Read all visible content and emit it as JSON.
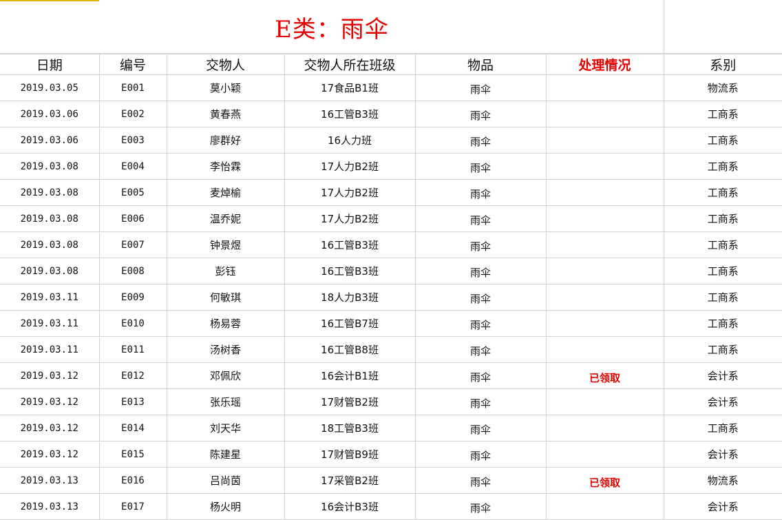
{
  "title": "E类：雨伞",
  "headers": {
    "date": "日期",
    "number": "编号",
    "person": "交物人",
    "class": "交物人所在班级",
    "item": "物品",
    "status": "处理情况",
    "department": "系别"
  },
  "rows": [
    {
      "date": "2019.03.05",
      "number": "E001",
      "person": "莫小颖",
      "class": "17食品B1班",
      "item": "雨伞",
      "status": "",
      "department": "物流系"
    },
    {
      "date": "2019.03.06",
      "number": "E002",
      "person": "黄春燕",
      "class": "16工管B3班",
      "item": "雨伞",
      "status": "",
      "department": "工商系"
    },
    {
      "date": "2019.03.06",
      "number": "E003",
      "person": "廖群好",
      "class": "16人力班",
      "item": "雨伞",
      "status": "",
      "department": "工商系"
    },
    {
      "date": "2019.03.08",
      "number": "E004",
      "person": "李怡霖",
      "class": "17人力B2班",
      "item": "雨伞",
      "status": "",
      "department": "工商系"
    },
    {
      "date": "2019.03.08",
      "number": "E005",
      "person": "麦焯榆",
      "class": "17人力B2班",
      "item": "雨伞",
      "status": "",
      "department": "工商系"
    },
    {
      "date": "2019.03.08",
      "number": "E006",
      "person": "温乔妮",
      "class": "17人力B2班",
      "item": "雨伞",
      "status": "",
      "department": "工商系"
    },
    {
      "date": "2019.03.08",
      "number": "E007",
      "person": "钟景煜",
      "class": "16工管B3班",
      "item": "雨伞",
      "status": "",
      "department": "工商系"
    },
    {
      "date": "2019.03.08",
      "number": "E008",
      "person": "彭钰",
      "class": "16工管B3班",
      "item": "雨伞",
      "status": "",
      "department": "工商系"
    },
    {
      "date": "2019.03.11",
      "number": "E009",
      "person": "何敏琪",
      "class": "18人力B3班",
      "item": "雨伞",
      "status": "",
      "department": "工商系"
    },
    {
      "date": "2019.03.11",
      "number": "E010",
      "person": "杨易蓉",
      "class": "16工管B7班",
      "item": "雨伞",
      "status": "",
      "department": "工商系"
    },
    {
      "date": "2019.03.11",
      "number": "E011",
      "person": "汤树香",
      "class": "16工管B8班",
      "item": "雨伞",
      "status": "",
      "department": "工商系"
    },
    {
      "date": "2019.03.12",
      "number": "E012",
      "person": "邓佩欣",
      "class": "16会计B1班",
      "item": "雨伞",
      "status": "已领取",
      "department": "会计系"
    },
    {
      "date": "2019.03.12",
      "number": "E013",
      "person": "张乐瑶",
      "class": "17财管B2班",
      "item": "雨伞",
      "status": "",
      "department": "会计系"
    },
    {
      "date": "2019.03.12",
      "number": "E014",
      "person": "刘天华",
      "class": "18工管B3班",
      "item": "雨伞",
      "status": "",
      "department": "工商系"
    },
    {
      "date": "2019.03.12",
      "number": "E015",
      "person": "陈建星",
      "class": "17财管B9班",
      "item": "雨伞",
      "status": "",
      "department": "会计系"
    },
    {
      "date": "2019.03.13",
      "number": "E016",
      "person": "吕尚茵",
      "class": "17采管B2班",
      "item": "雨伞",
      "status": "已领取",
      "department": "物流系"
    },
    {
      "date": "2019.03.13",
      "number": "E017",
      "person": "杨火明",
      "class": "16会计B3班",
      "item": "雨伞",
      "status": "",
      "department": "会计系"
    }
  ]
}
